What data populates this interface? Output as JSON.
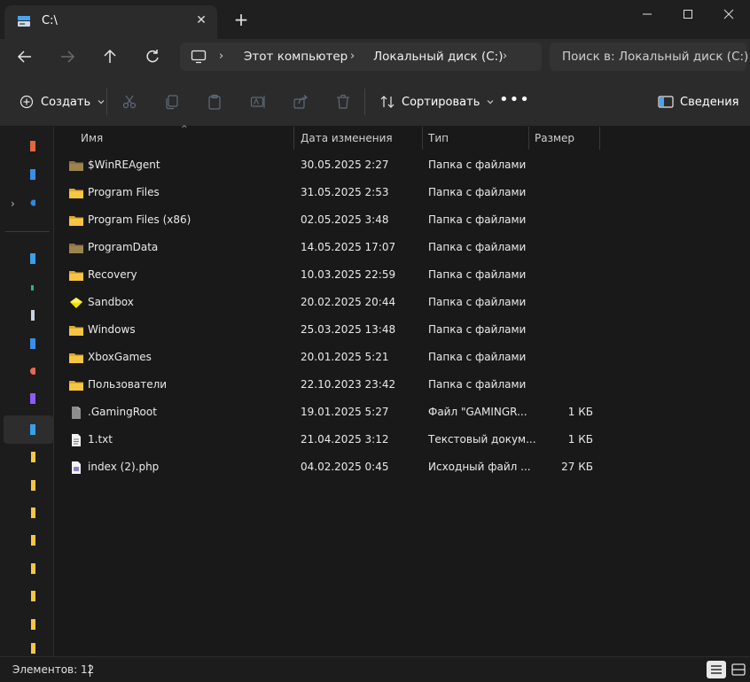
{
  "tab": {
    "title": "C:\\"
  },
  "breadcrumbs": [
    "Этот компьютер",
    "Локальный диск (C:)"
  ],
  "search": {
    "placeholder": "Поиск в: Локальный диск (C:)"
  },
  "toolbar": {
    "create_label": "Создать",
    "sort_label": "Сортировать",
    "more_label": "•••",
    "details_label": "Сведения"
  },
  "columns": {
    "name": "Имя",
    "date": "Дата изменения",
    "type": "Тип",
    "size": "Размер"
  },
  "files": [
    {
      "name": "$WinREAgent",
      "date": "30.05.2025 2:27",
      "type": "Папка с файлами",
      "size": "",
      "icon": "folder-dim-icon"
    },
    {
      "name": "Program Files",
      "date": "31.05.2025 2:53",
      "type": "Папка с файлами",
      "size": "",
      "icon": "folder-icon"
    },
    {
      "name": "Program Files (x86)",
      "date": "02.05.2025 3:48",
      "type": "Папка с файлами",
      "size": "",
      "icon": "folder-icon"
    },
    {
      "name": "ProgramData",
      "date": "14.05.2025 17:07",
      "type": "Папка с файлами",
      "size": "",
      "icon": "folder-dim-icon"
    },
    {
      "name": "Recovery",
      "date": "10.03.2025 22:59",
      "type": "Папка с файлами",
      "size": "",
      "icon": "folder-icon"
    },
    {
      "name": "Sandbox",
      "date": "20.02.2025 20:44",
      "type": "Папка с файлами",
      "size": "",
      "icon": "sandbox-icon"
    },
    {
      "name": "Windows",
      "date": "25.03.2025 13:48",
      "type": "Папка с файлами",
      "size": "",
      "icon": "folder-icon"
    },
    {
      "name": "XboxGames",
      "date": "20.01.2025 5:21",
      "type": "Папка с файлами",
      "size": "",
      "icon": "folder-icon"
    },
    {
      "name": "Пользователи",
      "date": "22.10.2023 23:42",
      "type": "Папка с файлами",
      "size": "",
      "icon": "folder-icon"
    },
    {
      "name": ".GamingRoot",
      "date": "19.01.2025 5:27",
      "type": "Файл \"GAMINGR...",
      "size": "1 КБ",
      "icon": "file-dim-icon"
    },
    {
      "name": "1.txt",
      "date": "21.04.2025 3:12",
      "type": "Текстовый докум...",
      "size": "1 КБ",
      "icon": "text-file-icon"
    },
    {
      "name": "index (2).php",
      "date": "04.02.2025 0:45",
      "type": "Исходный файл ...",
      "size": "27 КБ",
      "icon": "php-file-icon"
    }
  ],
  "status": {
    "count_text": "Элементов: 12"
  },
  "colors": {
    "folder": "#f6c544",
    "folder_dim": "#8a7440",
    "accent": "#4aa3f0",
    "background": "#191919"
  }
}
